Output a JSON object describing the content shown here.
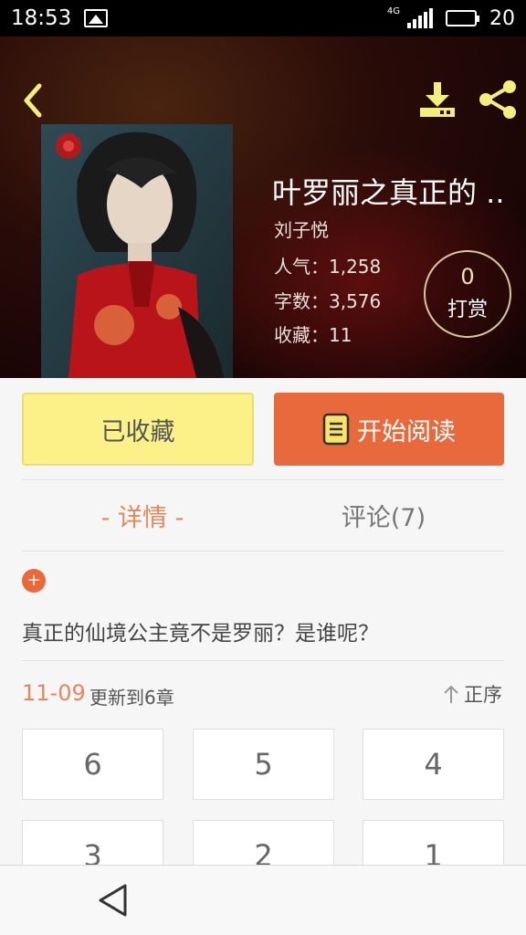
{
  "status_bar": {
    "time": "18:53",
    "network": "4G",
    "battery": "20"
  },
  "header": {
    "title": "叶罗丽之真正的 ..",
    "author": "刘子悦",
    "stats": {
      "popularity": "人气：1,258",
      "words": "字数：3,576",
      "favorites": "收藏：11"
    },
    "reward": {
      "count": "0",
      "label": "打赏"
    }
  },
  "actions": {
    "favorite_label": "已收藏",
    "read_label": "开始阅读"
  },
  "tabs": {
    "detail": "- 详情 -",
    "comments": "评论(7)"
  },
  "synopsis": "真正的仙境公主竟不是罗丽？是谁呢？",
  "update": {
    "date": "11-09",
    "text": "更新到6章",
    "sort_label": "正序"
  },
  "chapters": [
    "6",
    "5",
    "4",
    "3",
    "2",
    "1"
  ],
  "colors": {
    "accent": "#e86a3c",
    "fav_button": "#fbf188",
    "header_icon": "#f4ef7c"
  },
  "icons": [
    "image-icon",
    "signal-icon",
    "battery-icon",
    "back-icon",
    "download-icon",
    "share-icon",
    "book-icon",
    "plus-icon",
    "sort-up-icon",
    "nav-back-icon"
  ]
}
